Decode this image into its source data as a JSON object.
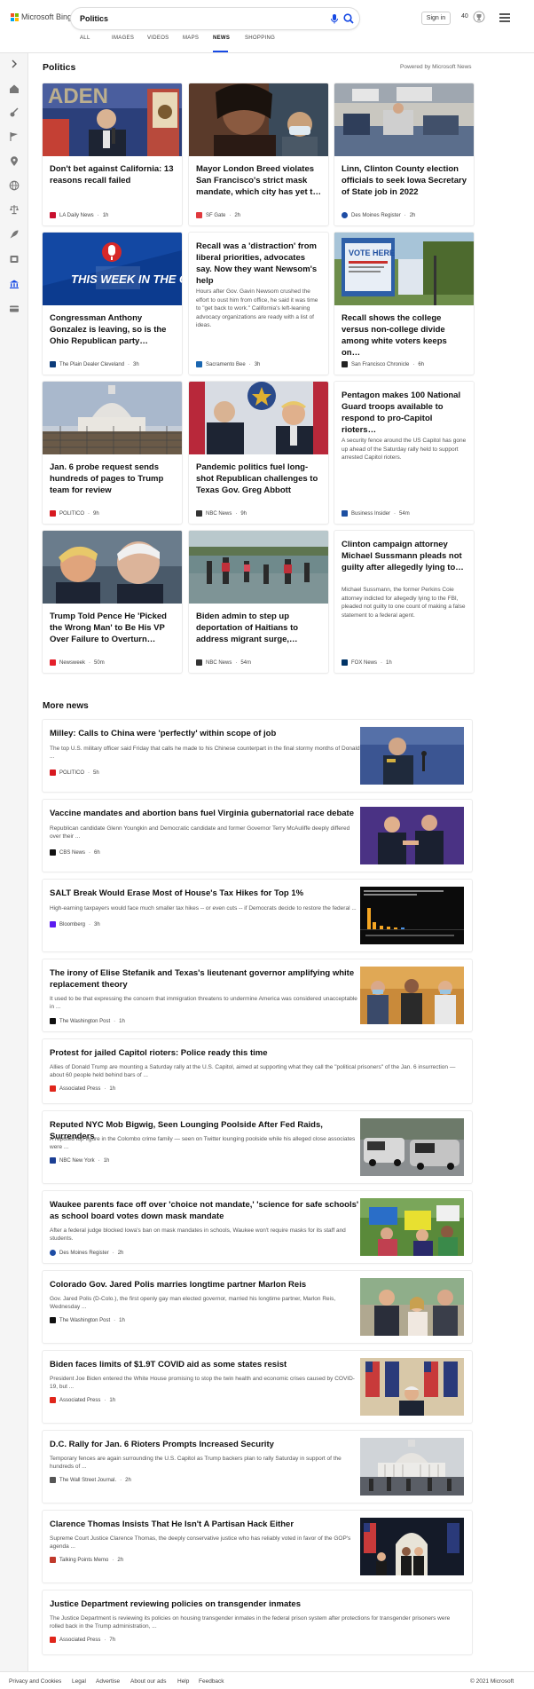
{
  "header": {
    "brand": "Microsoft Bing",
    "search_value": "Politics",
    "signin": "Sign in",
    "points": "40",
    "logo_colors": [
      "#f25022",
      "#7fba00",
      "#00a4ef",
      "#ffb900"
    ],
    "tabs": [
      {
        "label": "ALL"
      },
      {
        "label": "IMAGES"
      },
      {
        "label": "VIDEOS"
      },
      {
        "label": "MAPS"
      },
      {
        "label": "NEWS"
      },
      {
        "label": "SHOPPING"
      }
    ],
    "active_tab": "NEWS",
    "accent_color": "#174ae4"
  },
  "rail": {
    "icons": [
      "chevron-right-icon",
      "home-icon",
      "sports-icon",
      "flag-icon",
      "location-icon",
      "globe-icon",
      "scales-icon",
      "rocket-icon",
      "film-icon",
      "bank-icon",
      "card-icon"
    ]
  },
  "section": {
    "title": "Politics",
    "powered_by": "Powered by Microsoft News"
  },
  "cards": [
    {
      "title": "Don't bet against California: 13 reasons recall failed",
      "source": "LA Daily News",
      "time": "1h",
      "favicon_color": "#c8102e",
      "image": "press-conference-photo"
    },
    {
      "title": "Mayor London Breed violates San Francisco's strict mask mandate, which city has yet t…",
      "source": "SF Gate",
      "time": "2h",
      "favicon_color": "#e03a3e",
      "image": "mayor-photo"
    },
    {
      "title": "Linn, Clinton County election officials to seek Iowa Secretary of State job in 2022",
      "source": "Des Moines Register",
      "time": "2h",
      "favicon_color": "#1d4ca4",
      "image": "election-office-photo"
    },
    {
      "title": "Congressman Anthony Gonzalez is leaving, so is the Ohio Republican party…",
      "source": "The Plain Dealer Cleveland",
      "time": "3h",
      "favicon_color": "#0c3b7a",
      "image": "this-week-in-the-cle-graphic",
      "graphic_text": "THIS WEEK IN THE CLE"
    },
    {
      "title": "Recall was a 'distraction' from liberal priorities, advocates say. Now they want Newsom's help",
      "snippet": "Hours after Gov. Gavin Newsom crushed the effort to oust him from office, he said it was time to \"get back to work.\" California's left-leaning advocacy organizations are ready with a list of ideas.",
      "source": "Sacramento Bee",
      "time": "3h",
      "favicon_color": "#1a66b0"
    },
    {
      "title": "Recall shows the college versus non-college divide among white voters keeps on…",
      "source": "San Francisco Chronicle",
      "time": "6h",
      "favicon_color": "#222222",
      "image": "vote-here-sign-photo",
      "sign_text": "VOTE HERE"
    },
    {
      "title": "Jan. 6 probe request sends hundreds of pages to Trump team for review",
      "source": "POLITICO",
      "time": "9h",
      "favicon_color": "#d71920",
      "image": "capitol-photo"
    },
    {
      "title": "Pandemic politics fuel long-shot Republican challenges to Texas Gov. Greg Abbott",
      "source": "NBC News",
      "time": "9h",
      "favicon_color": "#333333",
      "image": "governor-trump-photo"
    },
    {
      "title": "Pentagon makes 100 National Guard troops available to respond to pro-Capitol rioters…",
      "snippet": "A security fence around the US Capitol has gone up ahead of the Saturday rally held to support arrested Capitol rioters.",
      "source": "Business Insider",
      "time": "54m",
      "favicon_color": "#1c4fa1"
    },
    {
      "title": "Trump Told Pence He 'Picked the Wrong Man' to Be His VP Over Failure to Overturn…",
      "source": "Newsweek",
      "time": "50m",
      "favicon_color": "#e4202b",
      "image": "trump-pence-photo"
    },
    {
      "title": "Biden admin to step up deportation of Haitians to address migrant surge,…",
      "source": "NBC News",
      "time": "54m",
      "favicon_color": "#333333",
      "image": "migrants-river-photo"
    },
    {
      "title": "Clinton campaign attorney Michael Sussmann pleads not guilty after allegedly lying to…",
      "snippet": "Michael Sussmann, the former Perkins Coie attorney indicted for allegedly lying to the FBI, pleaded not guilty to one count of making a false statement to a federal agent.",
      "source": "FOX News",
      "time": "1h",
      "favicon_color": "#003366"
    }
  ],
  "more_news": {
    "title": "More news",
    "items": [
      {
        "title": "Milley: Calls to China were 'perfectly' within scope of job",
        "snippet": "The top U.S. military officer said Friday that calls he made to his Chinese counterpart in the final stormy months of Donald ...",
        "source": "POLITICO",
        "time": "5h",
        "favicon_color": "#d71920",
        "thumb": "general-podium-photo"
      },
      {
        "title": "Vaccine mandates and abortion bans fuel Virginia gubernatorial race debate",
        "snippet": "Republican candidate Glenn Youngkin and Democratic candidate and former Governor Terry McAuliffe deeply differed over their ...",
        "source": "CBS News",
        "time": "6h",
        "favicon_color": "#111111",
        "thumb": "debate-handshake-photo"
      },
      {
        "title": "SALT Break Would Erase Most of House's Tax Hikes for Top 1%",
        "snippet": "High-earning taxpayers would face much smaller tax hikes -- or even cuts -- if Democrats decide to restore the federal ...",
        "source": "Bloomberg",
        "time": "3h",
        "favicon_color": "#5b1bf0",
        "thumb": "bar-chart-graphic"
      },
      {
        "title": "The irony of Elise Stefanik and Texas's lieutenant governor amplifying white replacement theory",
        "snippet": "It used to be that expressing the concern that immigration threatens to undermine America was considered unacceptable in ...",
        "source": "The Washington Post",
        "time": "1h",
        "favicon_color": "#111111",
        "thumb": "crowd-masks-photo"
      },
      {
        "title": "Protest for jailed Capitol rioters: Police ready this time",
        "snippet": "Allies of Donald Trump are mounting a Saturday rally at the U.S. Capitol, aimed at supporting what they call the \"political prisoners\" of the Jan. 6 insurrection — about 60 people held behind bars of ...",
        "source": "Associated Press",
        "time": "1h",
        "favicon_color": "#e0261b"
      },
      {
        "title": "Reputed NYC Mob Bigwig, Seen Lounging Poolside After Fed Raids, Surrenders",
        "snippet": "A reputed top figure in the Colombo crime family — seen on Twitter lounging poolside while his alleged close associates were ...",
        "source": "NBC New York",
        "time": "1h",
        "favicon_color": "#1c3f94",
        "thumb": "vans-street-photo"
      },
      {
        "title": "Waukee parents face off over 'choice not mandate,' 'science for safe schools' as school board votes down mask mandate",
        "snippet": "After a federal judge blocked Iowa's ban on mask mandates in schools, Waukee won't require masks for its staff and students.",
        "source": "Des Moines Register",
        "time": "2h",
        "favicon_color": "#1d4ca4",
        "thumb": "protest-signs-photo"
      },
      {
        "title": "Colorado Gov. Jared Polis marries longtime partner Marlon Reis",
        "snippet": "Gov. Jared Polis (D-Colo.), the first openly gay man elected governor, married his longtime partner, Marlon Reis, Wednesday ...",
        "source": "The Washington Post",
        "time": "1h",
        "favicon_color": "#111111",
        "thumb": "wedding-photo"
      },
      {
        "title": "Biden faces limits of $1.9T COVID aid as some states resist",
        "snippet": "President Joe Biden entered the White House promising to stop the twin health and economic crises caused by COVID-19, but ...",
        "source": "Associated Press",
        "time": "1h",
        "favicon_color": "#e0261b",
        "thumb": "flags-podium-photo"
      },
      {
        "title": "D.C. Rally for Jan. 6 Rioters Prompts Increased Security",
        "snippet": "Temporary fences are again surrounding the U.S. Capitol as Trump backers plan to rally Saturday in support of the hundreds of ...",
        "source": "The Wall Street Journal.",
        "time": "2h",
        "favicon_color": "#555555",
        "thumb": "capitol-crowd-photo"
      },
      {
        "title": "Clarence Thomas Insists That He Isn't A Partisan Hack Either",
        "snippet": "Supreme Court Justice Clarence Thomas, the deeply conservative justice who has reliably voted in favor of the GOP's agenda ...",
        "source": "Talking Points Memo",
        "time": "2h",
        "favicon_color": "#c0392b",
        "thumb": "ceremony-photo"
      },
      {
        "title": "Justice Department reviewing policies on transgender inmates",
        "snippet": "The Justice Department is reviewing its policies on housing transgender inmates in the federal prison system after protections for transgender prisoners were rolled back in the Trump administration, ...",
        "source": "Associated Press",
        "time": "7h",
        "favicon_color": "#e0261b"
      }
    ]
  },
  "footer": {
    "links": [
      "Privacy and Cookies",
      "Legal",
      "Advertise",
      "About our ads",
      "Help",
      "Feedback"
    ],
    "copyright": "© 2021 Microsoft"
  }
}
